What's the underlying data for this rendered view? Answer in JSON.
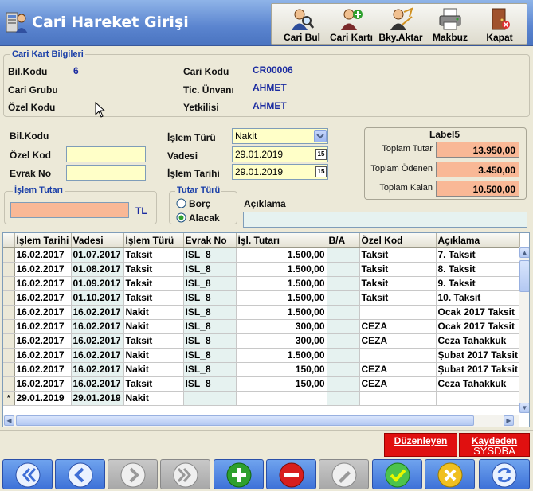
{
  "window": {
    "title": "Cari Hareket Girişi"
  },
  "toolbar": [
    {
      "label": "Cari Bul",
      "icon": "search-person-icon"
    },
    {
      "label": "Cari Kartı",
      "icon": "add-person-icon"
    },
    {
      "label": "Bky.Aktar",
      "icon": "transfer-person-icon"
    },
    {
      "label": "Makbuz",
      "icon": "printer-icon"
    },
    {
      "label": "Kapat",
      "icon": "exit-door-icon"
    }
  ],
  "cari_kart": {
    "group_title": "Cari Kart Bilgileri",
    "bil_kodu_label": "Bil.Kodu",
    "bil_kodu_value": "6",
    "cari_grubu_label": "Cari Grubu",
    "ozel_kodu_label": "Özel Kodu",
    "cari_kodu_label": "Cari Kodu",
    "cari_kodu_value": "CR00006",
    "tic_unvani_label": "Tic. Ünvanı",
    "tic_unvani_value": "AHMET",
    "yetkilisi_label": "Yetkilisi",
    "yetkilisi_value": "AHMET"
  },
  "form": {
    "bil_kodu_label": "Bil.Kodu",
    "ozel_kod_label": "Özel Kod",
    "ozel_kod_value": "",
    "evrak_no_label": "Evrak No",
    "evrak_no_value": "",
    "islem_turu_label": "İşlem Türü",
    "islem_turu_value": "Nakit",
    "vadesi_label": "Vadesi",
    "vadesi_value": "29.01.2019",
    "islem_tarihi_label": "İşlem Tarihi",
    "islem_tarihi_value": "29.01.2019",
    "islem_tutari_title": "İşlem Tutarı",
    "islem_tutari_value": "",
    "currency": "TL",
    "tutar_turu_title": "Tutar Türü",
    "borc_label": "Borç",
    "alacak_label": "Alacak",
    "selected": "Alacak",
    "aciklama_label": "Açıklama",
    "aciklama_value": ""
  },
  "totals": {
    "title": "Label5",
    "toplam_tutar_label": "Toplam Tutar",
    "toplam_tutar_value": "13.950,00",
    "toplam_odenen_label": "Toplam Ödenen",
    "toplam_odenen_value": "3.450,00",
    "toplam_kalan_label": "Toplam Kalan",
    "toplam_kalan_value": "10.500,00"
  },
  "grid": {
    "columns": [
      "İşlem Tarihi",
      "Vadesi",
      "İşlem Türü",
      "Evrak No",
      "İşl. Tutarı",
      "B/A",
      "Özel Kod",
      "Açıklama"
    ],
    "rows": [
      [
        "16.02.2017",
        "01.07.2017",
        "Taksit",
        "ISL_8",
        "1.500,00",
        "",
        "Taksit",
        "7. Taksit"
      ],
      [
        "16.02.2017",
        "01.08.2017",
        "Taksit",
        "ISL_8",
        "1.500,00",
        "",
        "Taksit",
        "8. Taksit"
      ],
      [
        "16.02.2017",
        "01.09.2017",
        "Taksit",
        "ISL_8",
        "1.500,00",
        "",
        "Taksit",
        "9. Taksit"
      ],
      [
        "16.02.2017",
        "01.10.2017",
        "Taksit",
        "ISL_8",
        "1.500,00",
        "",
        "Taksit",
        "10. Taksit"
      ],
      [
        "16.02.2017",
        "16.02.2017",
        "Nakit",
        "ISL_8",
        "1.500,00",
        "",
        "",
        "Ocak 2017 Taksit"
      ],
      [
        "16.02.2017",
        "16.02.2017",
        "Nakit",
        "ISL_8",
        "300,00",
        "",
        "CEZA",
        "Ocak 2017 Taksit"
      ],
      [
        "16.02.2017",
        "16.02.2017",
        "Taksit",
        "ISL_8",
        "300,00",
        "",
        "CEZA",
        "Ceza Tahakkuk"
      ],
      [
        "16.02.2017",
        "16.02.2017",
        "Nakit",
        "ISL_8",
        "1.500,00",
        "",
        "",
        "Şubat 2017 Taksit"
      ],
      [
        "16.02.2017",
        "16.02.2017",
        "Nakit",
        "ISL_8",
        "150,00",
        "",
        "CEZA",
        "Şubat 2017 Taksit"
      ],
      [
        "16.02.2017",
        "16.02.2017",
        "Taksit",
        "ISL_8",
        "150,00",
        "",
        "CEZA",
        "Ceza Tahakkuk"
      ],
      [
        "29.01.2019",
        "29.01.2019",
        "Nakit",
        "",
        "",
        "",
        "",
        ""
      ]
    ],
    "new_row_marker": "*"
  },
  "status": {
    "duzenleyen_label": "Düzenleyen",
    "duzenleyen_value": "",
    "kaydeden_label": "Kaydeden",
    "kaydeden_value": "SYSDBA"
  },
  "navigator": [
    {
      "icon": "first-record-icon"
    },
    {
      "icon": "previous-record-icon"
    },
    {
      "icon": "next-record-icon"
    },
    {
      "icon": "last-record-icon"
    },
    {
      "icon": "insert-record-icon"
    },
    {
      "icon": "delete-record-icon"
    },
    {
      "icon": "edit-record-icon"
    },
    {
      "icon": "post-record-icon"
    },
    {
      "icon": "cancel-record-icon"
    },
    {
      "icon": "refresh-icon"
    }
  ]
}
